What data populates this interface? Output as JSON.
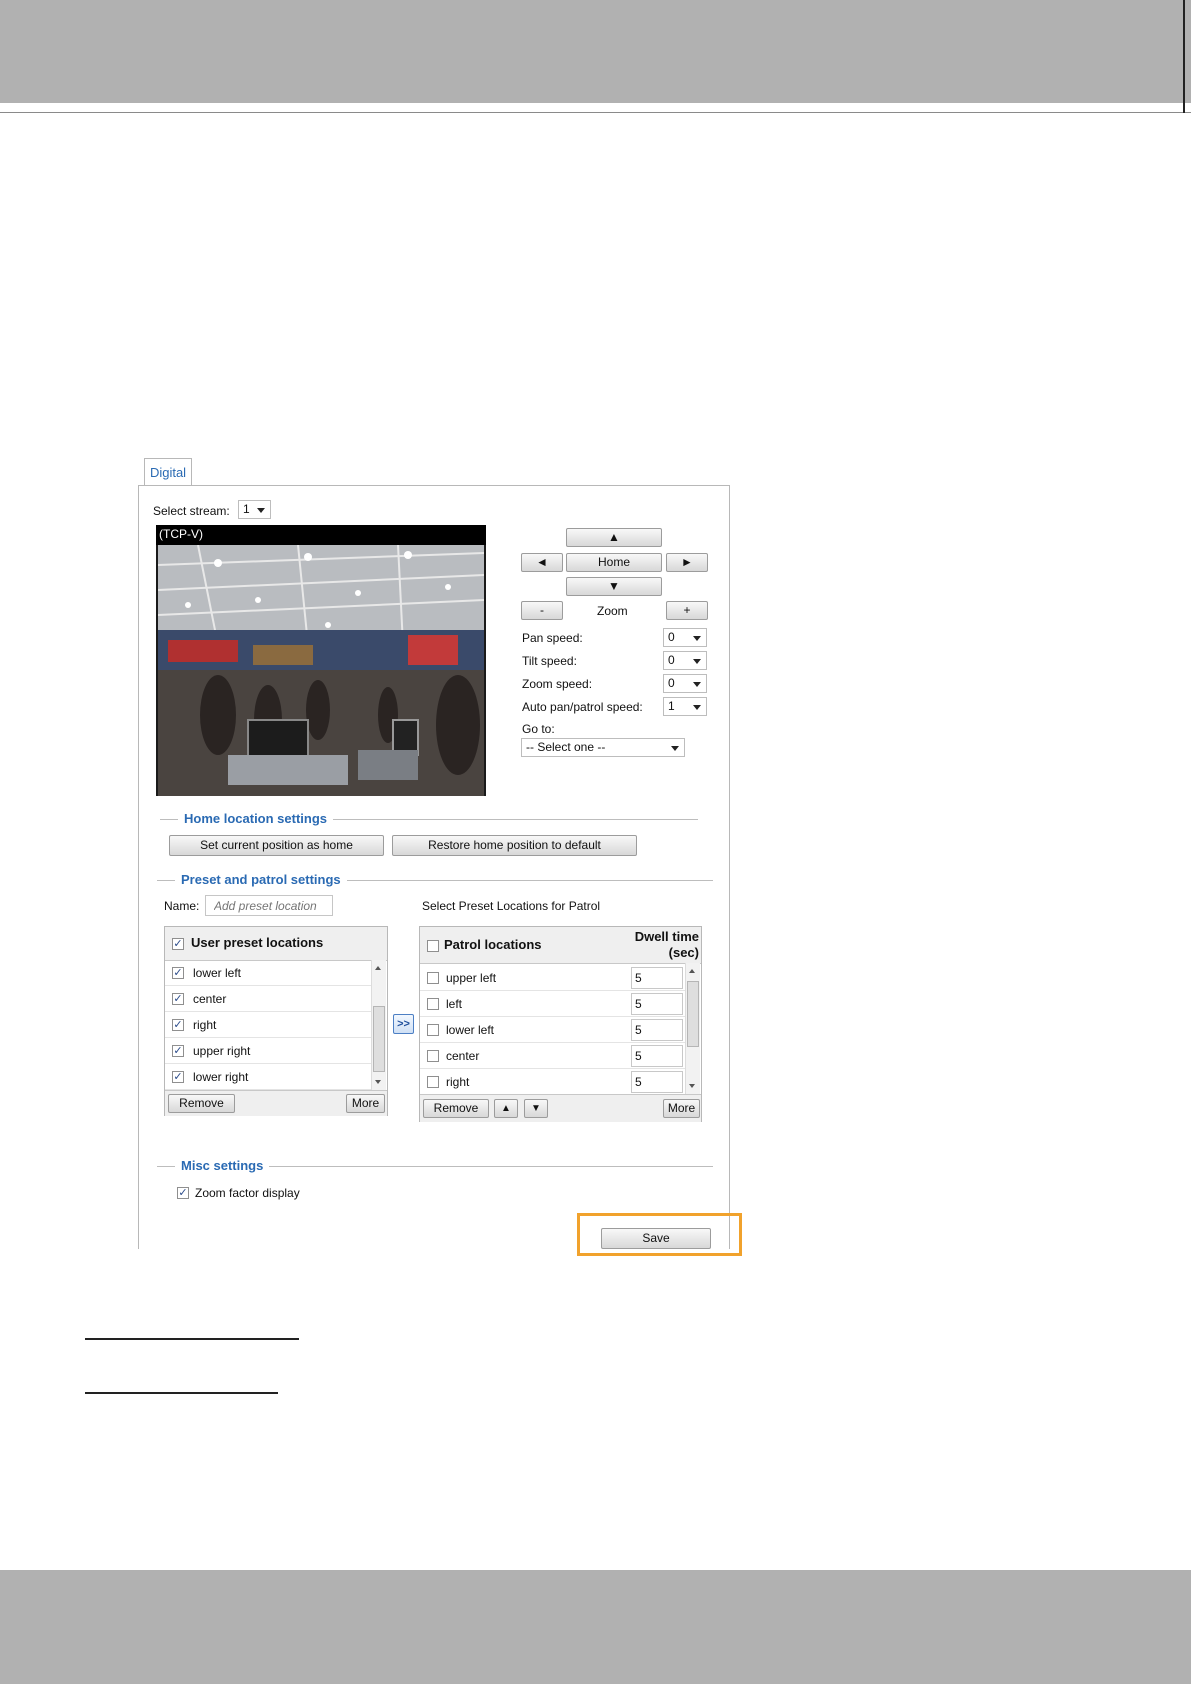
{
  "tab": {
    "label": "Digital"
  },
  "stream": {
    "label": "Select stream:",
    "value": "1"
  },
  "video": {
    "header": "(TCP-V)"
  },
  "ptz": {
    "up": "▲",
    "left": "◄",
    "home": "Home",
    "right": "►",
    "down": "▼",
    "zoom_out": "-",
    "zoom_label": "Zoom",
    "zoom_in": "+"
  },
  "speeds": [
    {
      "label": "Pan speed:",
      "value": "0"
    },
    {
      "label": "Tilt speed:",
      "value": "0"
    },
    {
      "label": "Zoom speed:",
      "value": "0"
    },
    {
      "label": "Auto pan/patrol speed:",
      "value": "1"
    }
  ],
  "goto": {
    "label": "Go to:",
    "value": "-- Select one --"
  },
  "home_section": {
    "title": "Home location settings",
    "set_btn": "Set current position as home",
    "restore_btn": "Restore home position to default"
  },
  "preset_section": {
    "title": "Preset and patrol settings",
    "name_label": "Name:",
    "name_placeholder": "Add preset location",
    "patrol_caption": "Select Preset Locations for Patrol",
    "user_header": "User preset locations",
    "user_items": [
      "lower left",
      "center",
      "right",
      "upper right",
      "lower right"
    ],
    "user_remove": "Remove",
    "user_more": "More",
    "add_btn": ">>",
    "patrol_header": "Patrol locations",
    "dwell_header_1": "Dwell time",
    "dwell_header_2": "(sec)",
    "patrol_items": [
      {
        "name": "upper left",
        "dwell": "5"
      },
      {
        "name": "left",
        "dwell": "5"
      },
      {
        "name": "lower left",
        "dwell": "5"
      },
      {
        "name": "center",
        "dwell": "5"
      },
      {
        "name": "right",
        "dwell": "5"
      }
    ],
    "patrol_remove": "Remove",
    "patrol_up": "▲",
    "patrol_down": "▼",
    "patrol_more": "More"
  },
  "misc_section": {
    "title": "Misc settings",
    "zoom_factor_label": "Zoom factor display"
  },
  "save": {
    "label": "Save"
  },
  "colors": {
    "accent": "#2a6ab3",
    "highlight": "#f1a22c",
    "band": "#b1b1b1"
  }
}
